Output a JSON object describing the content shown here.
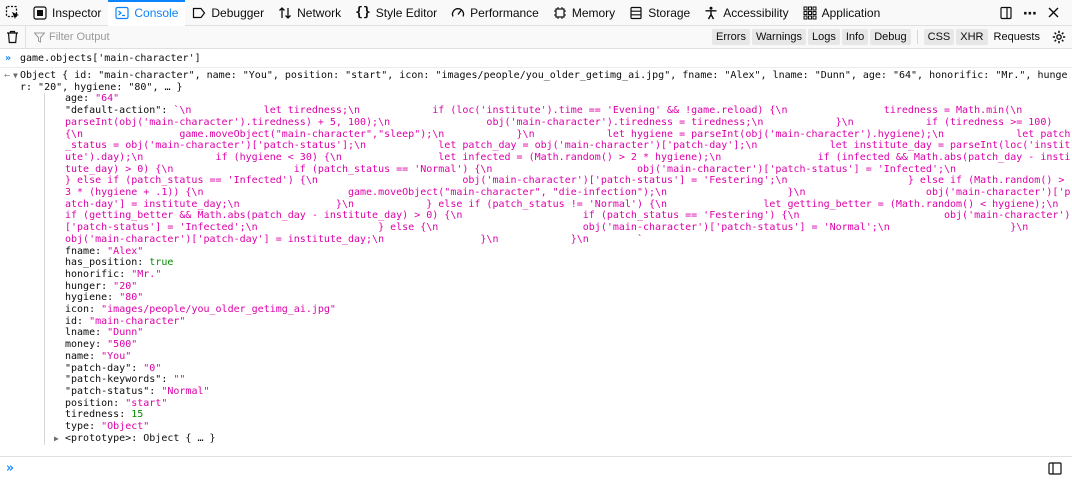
{
  "toolbar": {
    "tabs": [
      {
        "label": "Inspector",
        "icon": "inspector-icon"
      },
      {
        "label": "Console",
        "icon": "console-icon",
        "selected": true
      },
      {
        "label": "Debugger",
        "icon": "debugger-icon"
      },
      {
        "label": "Network",
        "icon": "network-icon"
      },
      {
        "label": "Style Editor",
        "icon": "style-editor-icon"
      },
      {
        "label": "Performance",
        "icon": "performance-icon"
      },
      {
        "label": "Memory",
        "icon": "memory-icon"
      },
      {
        "label": "Storage",
        "icon": "storage-icon"
      },
      {
        "label": "Accessibility",
        "icon": "accessibility-icon"
      },
      {
        "label": "Application",
        "icon": "application-icon"
      }
    ]
  },
  "filter": {
    "placeholder": "Filter Output",
    "buttons": [
      "Errors",
      "Warnings",
      "Logs",
      "Info",
      "Debug"
    ],
    "net_buttons": [
      "CSS",
      "XHR",
      "Requests"
    ]
  },
  "console": {
    "input": "game.objects['main-character']",
    "summary_prefix": "Object { ",
    "summary_rest": "id: \"main-character\", name: \"You\", position: \"start\", icon: \"images/people/you_older_getimg_ai.jpg\", fname: \"Alex\", lname: \"Dunn\", age: \"64\", honorific: \"Mr.\", hunger: \"20\", hygiene: \"80\", … }",
    "props": [
      {
        "k": "age",
        "v": "\"64\"",
        "t": "str"
      },
      {
        "k": "\"default-action\"",
        "v": "`\\n            let tiredness;\\n            if (loc('institute').time == 'Evening' && !game.reload) {\\n                tiredness = Math.min(\\n                    parseInt(obj('main-character').tiredness) + 5, 100);\\n                obj('main-character').tiredness = tiredness;\\n            }\\n            if (tiredness >= 100) {\\n                game.moveObject(\"main-character\",\"sleep\");\\n            }\\n            let hygiene = parseInt(obj('main-character').hygiene);\\n            let patch_status = obj('main-character')['patch-status'];\\n            let patch_day = obj('main-character')['patch-day'];\\n            let institute_day = parseInt(loc('institute').day);\\n            if (hygiene < 30) {\\n                let infected = (Math.random() > 2 * hygiene);\\n                if (infected && Math.abs(patch_day - institute_day) > 0) {\\n                    if (patch_status == 'Normal') {\\n                        obj('main-character')['patch-status'] = 'Infected';\\n                    } else if (patch_status == 'Infected') {\\n                        obj('main-character')['patch-status'] = 'Festering';\\n                    } else if (Math.random() > 3 * (hygiene + .1)) {\\n                        game.moveObject(\"main-character\", \"die-infection\");\\n                    }\\n                    obj('main-character')['patch-day'] = institute_day;\\n                }\\n            } else if (patch_status != 'Normal') {\\n                let getting_better = (Math.random() < hygiene);\\n                if (getting_better && Math.abs(patch_day - institute_day) > 0) {\\n                    if (patch_status == 'Festering') {\\n                        obj('main-character')['patch-status'] = 'Infected';\\n                    } else {\\n                        obj('main-character')['patch-status'] = 'Normal';\\n                    }\\n                    obj('main-character')['patch-day'] = institute_day;\\n                }\\n            }\\n        `",
        "t": "str"
      },
      {
        "k": "fname",
        "v": "\"Alex\"",
        "t": "str"
      },
      {
        "k": "has_position",
        "v": "true",
        "t": "bool"
      },
      {
        "k": "honorific",
        "v": "\"Mr.\"",
        "t": "str"
      },
      {
        "k": "hunger",
        "v": "\"20\"",
        "t": "str"
      },
      {
        "k": "hygiene",
        "v": "\"80\"",
        "t": "str"
      },
      {
        "k": "icon",
        "v": "\"images/people/you_older_getimg_ai.jpg\"",
        "t": "str"
      },
      {
        "k": "id",
        "v": "\"main-character\"",
        "t": "str"
      },
      {
        "k": "lname",
        "v": "\"Dunn\"",
        "t": "str"
      },
      {
        "k": "money",
        "v": "\"500\"",
        "t": "str"
      },
      {
        "k": "name",
        "v": "\"You\"",
        "t": "str"
      },
      {
        "k": "\"patch-day\"",
        "v": "\"0\"",
        "t": "str"
      },
      {
        "k": "\"patch-keywords\"",
        "v": "\"\"",
        "t": "str"
      },
      {
        "k": "\"patch-status\"",
        "v": "\"Normal\"",
        "t": "str"
      },
      {
        "k": "position",
        "v": "\"start\"",
        "t": "str"
      },
      {
        "k": "tiredness",
        "v": "15",
        "t": "num"
      },
      {
        "k": "type",
        "v": "\"Object\"",
        "t": "str"
      }
    ],
    "prototype": "<prototype>: Object { … }"
  },
  "colors": {
    "accent": "#0a84ff",
    "string": "#dd00a9",
    "number": "#058b00"
  }
}
